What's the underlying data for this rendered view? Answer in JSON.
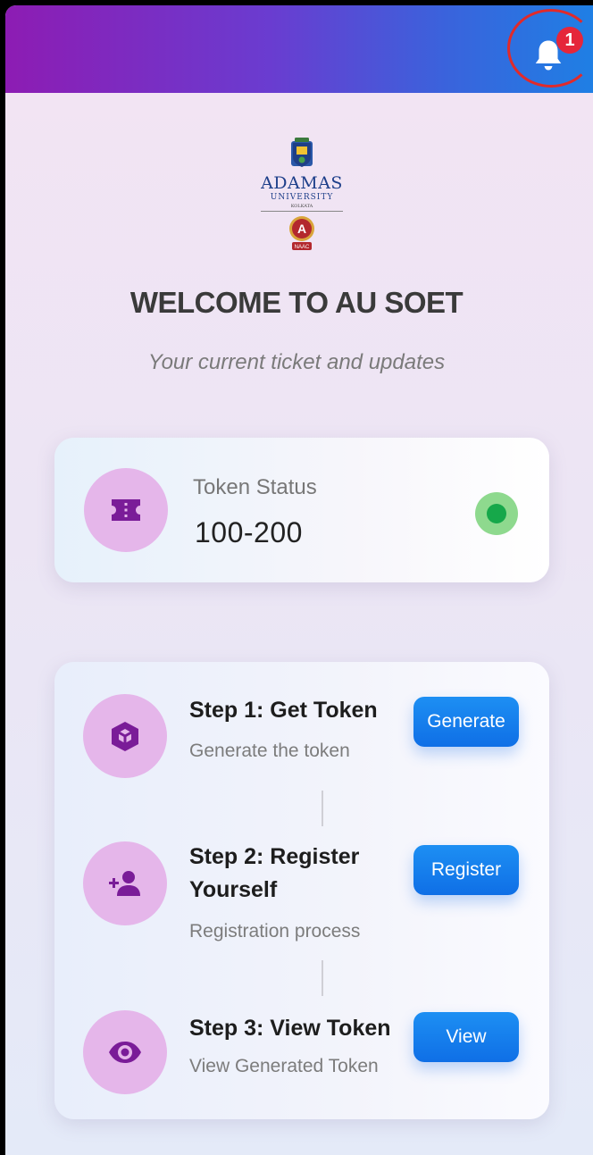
{
  "header": {
    "notification_count": "1"
  },
  "logo": {
    "name": "ADAMAS",
    "sub": "UNIVERSITY",
    "city": "KOLKATA",
    "naac_letter": "A",
    "naac_text": "NAAC"
  },
  "welcome": {
    "title": "WELCOME TO AU SOET",
    "subtitle": "Your current ticket and updates"
  },
  "token": {
    "label": "Token Status",
    "value": "100-200",
    "status_color": "#16a84a"
  },
  "steps": [
    {
      "title": "Step 1: Get Token",
      "desc": "Generate the token",
      "button": "Generate",
      "icon": "cube-icon"
    },
    {
      "title": "Step 2: Register Yourself",
      "desc": "Registration process",
      "button": "Register",
      "icon": "add-person-icon"
    },
    {
      "title": "Step 3: View Token",
      "desc": "View Generated Token",
      "button": "View",
      "icon": "eye-icon"
    }
  ],
  "colors": {
    "accent_purple": "#8d1cb3",
    "icon_purple": "#7a1c98",
    "circle_bg": "#e5b6ea",
    "button_blue": "#1d8ff3",
    "badge_red": "#e5263a"
  }
}
